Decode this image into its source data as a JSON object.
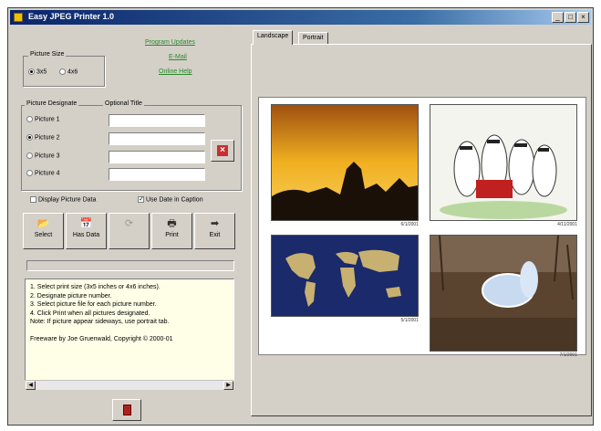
{
  "window": {
    "title": "Easy JPEG Printer 1.0",
    "controls": {
      "minimize": "_",
      "maximize": "□",
      "close": "×"
    }
  },
  "links": [
    "Program Updates",
    "E-Mail",
    "Online Help"
  ],
  "picture_size": {
    "label": "Picture Size",
    "options": [
      "3x5",
      "4x6"
    ],
    "selected": "3x5"
  },
  "designate": {
    "label": "Picture Designate",
    "optional_title_label": "Optional Title",
    "items": [
      {
        "label": "Picture 1",
        "checked": false,
        "title": ""
      },
      {
        "label": "Picture 2",
        "checked": true,
        "title": ""
      },
      {
        "label": "Picture 3",
        "checked": false,
        "title": ""
      },
      {
        "label": "Picture 4",
        "checked": false,
        "title": ""
      }
    ],
    "clear_icon": "x-icon"
  },
  "options": {
    "display_picture_data": {
      "label": "Display Picture Data",
      "checked": false
    },
    "use_date_in_caption": {
      "label": "Use Date in Caption",
      "checked": true
    }
  },
  "toolbar": [
    {
      "label": "Select",
      "icon": "folder-icon",
      "glyph": "📂",
      "enabled": true
    },
    {
      "label": "Has Data",
      "icon": "calendar-icon",
      "glyph": "📅",
      "enabled": true
    },
    {
      "label": "",
      "icon": "rotate-icon",
      "glyph": "⟳",
      "enabled": false
    },
    {
      "label": "Print",
      "icon": "printer-icon",
      "glyph": "🖶",
      "enabled": true
    },
    {
      "label": "Exit",
      "icon": "exit-icon",
      "glyph": "➡",
      "enabled": true
    }
  ],
  "instructions": [
    "1. Select print size (3x5 inches or 4x6 inches).",
    "2. Designate picture number.",
    "3. Select picture file for each picture number.",
    "4. Click Print when all pictures designated.",
    "Note: If picture appear sideways, use portrait tab.",
    "",
    "Freeware by Joe Gruenwald, Copyright © 2000-01"
  ],
  "trash_icon": "trash-icon",
  "tabs": [
    {
      "label": "Landscape",
      "active": true
    },
    {
      "label": "Portrait",
      "active": false
    }
  ],
  "preview": {
    "photos": [
      {
        "name": "sunset",
        "caption": "6/1/2001"
      },
      {
        "name": "cartoon",
        "caption": "4/11/2001"
      },
      {
        "name": "world-map",
        "caption": "5/1/2001"
      },
      {
        "name": "seal",
        "caption": "7/1/2001"
      }
    ]
  }
}
